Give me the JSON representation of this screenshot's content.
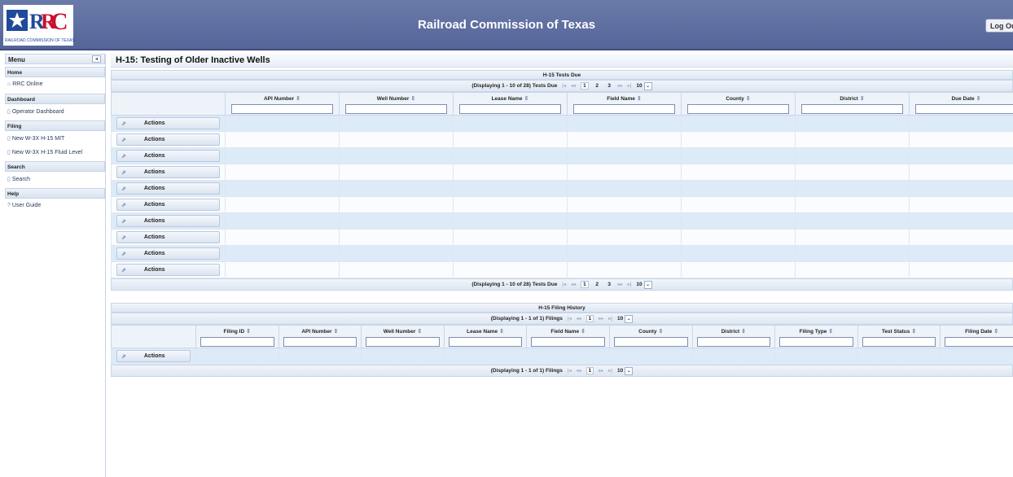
{
  "header": {
    "logo_text": "RRC",
    "logo_subtitle": "RAILROAD COMMISSION OF TEXAS",
    "title": "Railroad Commission of Texas",
    "logout_label": "Log Out"
  },
  "sidebar": {
    "title": "Menu",
    "collapse_icon": "◂",
    "sections": [
      {
        "label": "Home",
        "items": [
          {
            "icon": "home-icon",
            "glyph": "⌂",
            "label": "RRC Online"
          }
        ]
      },
      {
        "label": "Dashboard",
        "items": [
          {
            "icon": "document-icon",
            "glyph": "▯",
            "label": "Operator Dashboard"
          }
        ]
      },
      {
        "label": "Filing",
        "items": [
          {
            "icon": "document-icon",
            "glyph": "▯",
            "label": "New W-3X H-15 MIT"
          },
          {
            "icon": "document-icon",
            "glyph": "▯",
            "label": "New W-3X H-15 Fluid Level"
          }
        ]
      },
      {
        "label": "Search",
        "items": [
          {
            "icon": "document-icon",
            "glyph": "▯",
            "label": "Search"
          }
        ]
      },
      {
        "label": "Help",
        "items": [
          {
            "icon": "help-icon",
            "glyph": "?",
            "label": "User Guide"
          }
        ]
      }
    ]
  },
  "page_title": "H-15: Testing of Older Inactive Wells",
  "tests_due": {
    "title": "H-15 Tests Due",
    "pager_text": "(Displaying 1 - 10 of 28) Tests Due",
    "pages": [
      "1",
      "2",
      "3"
    ],
    "rows_per_page": "10",
    "columns": [
      "API Number",
      "Well Number",
      "Lease Name",
      "Field Name",
      "County",
      "District",
      "Due Date"
    ],
    "action_label": "Actions",
    "row_count": 10
  },
  "history": {
    "title": "H-15 Filing History",
    "pager_text": "(Displaying 1 - 1 of 1) Filings",
    "pages": [
      "1"
    ],
    "rows_per_page": "10",
    "columns": [
      "Filing ID",
      "API Number",
      "Well Number",
      "Lease Name",
      "Field Name",
      "County",
      "District",
      "Filing Type",
      "Test Status",
      "Filing Date"
    ],
    "action_label": "Actions",
    "row_count": 1
  },
  "glyphs": {
    "sort": "⇕",
    "first": "|◂",
    "prev": "◂◂",
    "next": "▸▸",
    "last": "▸|",
    "dropdown": "⌄",
    "action": "⇗"
  }
}
